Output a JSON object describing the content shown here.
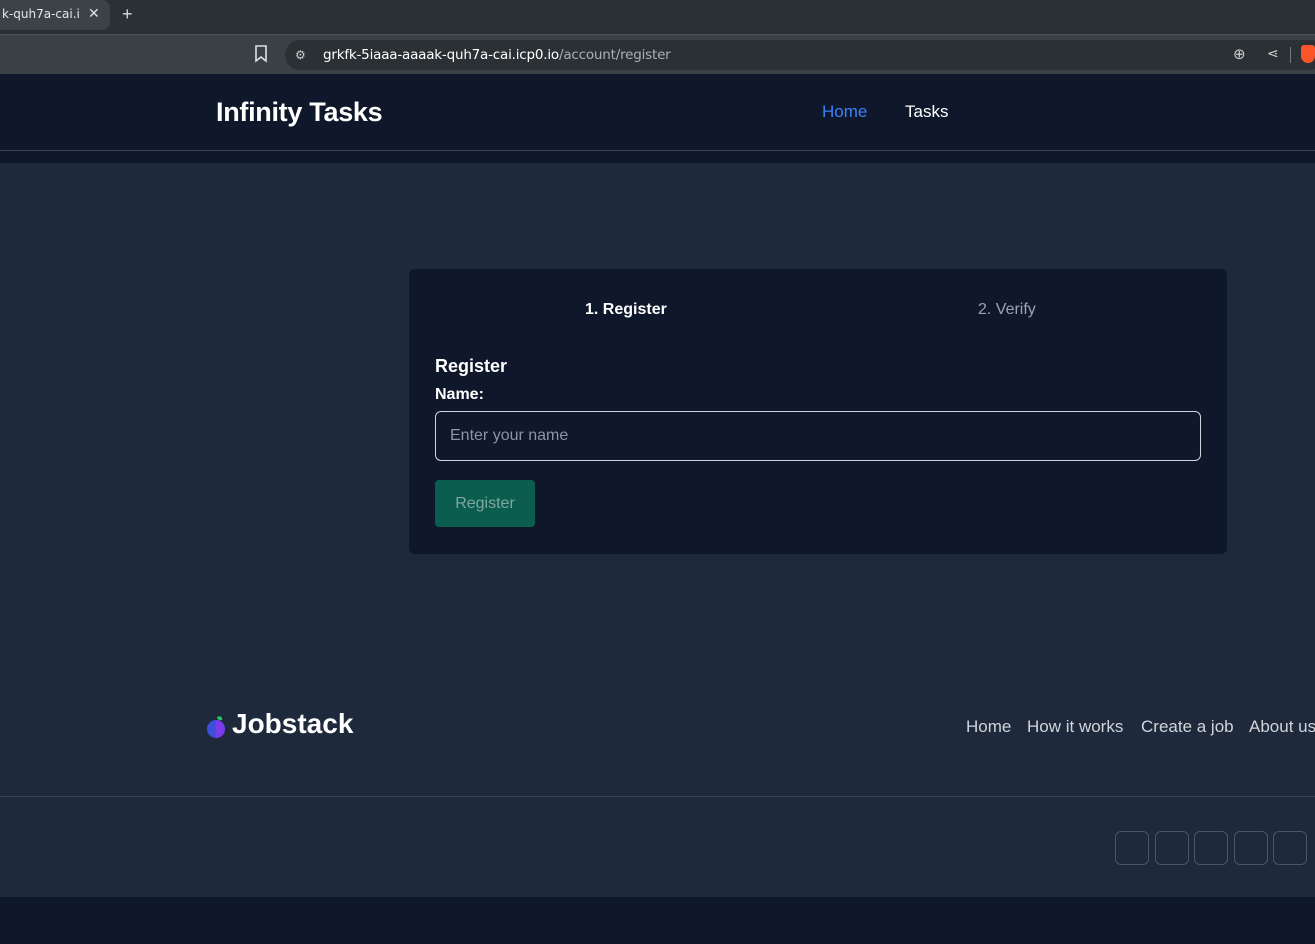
{
  "browser": {
    "tab_title": "k-quh7a-cai.i",
    "tab_close": "✕",
    "new_tab": "+",
    "url_host": "grkfk-5iaaa-aaaak-quh7a-cai.icp0.io",
    "url_path": "/account/register",
    "icons": [
      "bookmark-icon",
      "site-settings-icon",
      "zoom-icon",
      "share-icon",
      "brave-icon"
    ]
  },
  "header": {
    "brand": "Infinity Tasks",
    "nav": {
      "home": "Home",
      "tasks": "Tasks"
    },
    "active_color": "#3b82f6"
  },
  "register": {
    "steps": {
      "step1": "1. Register",
      "step2": "2. Verify"
    },
    "title": "Register",
    "name_label": "Name:",
    "name_placeholder": "Enter your name",
    "name_value": "",
    "submit_label": "Register",
    "button_color": "#0b5d4f"
  },
  "footer": {
    "logo_text": "Jobstack",
    "links": {
      "home": "Home",
      "how": "How it works",
      "create": "Create a job",
      "about": "About us"
    },
    "social_icons": [
      "social-icon-1",
      "social-icon-2",
      "social-icon-3",
      "social-icon-4",
      "social-icon-5"
    ]
  }
}
